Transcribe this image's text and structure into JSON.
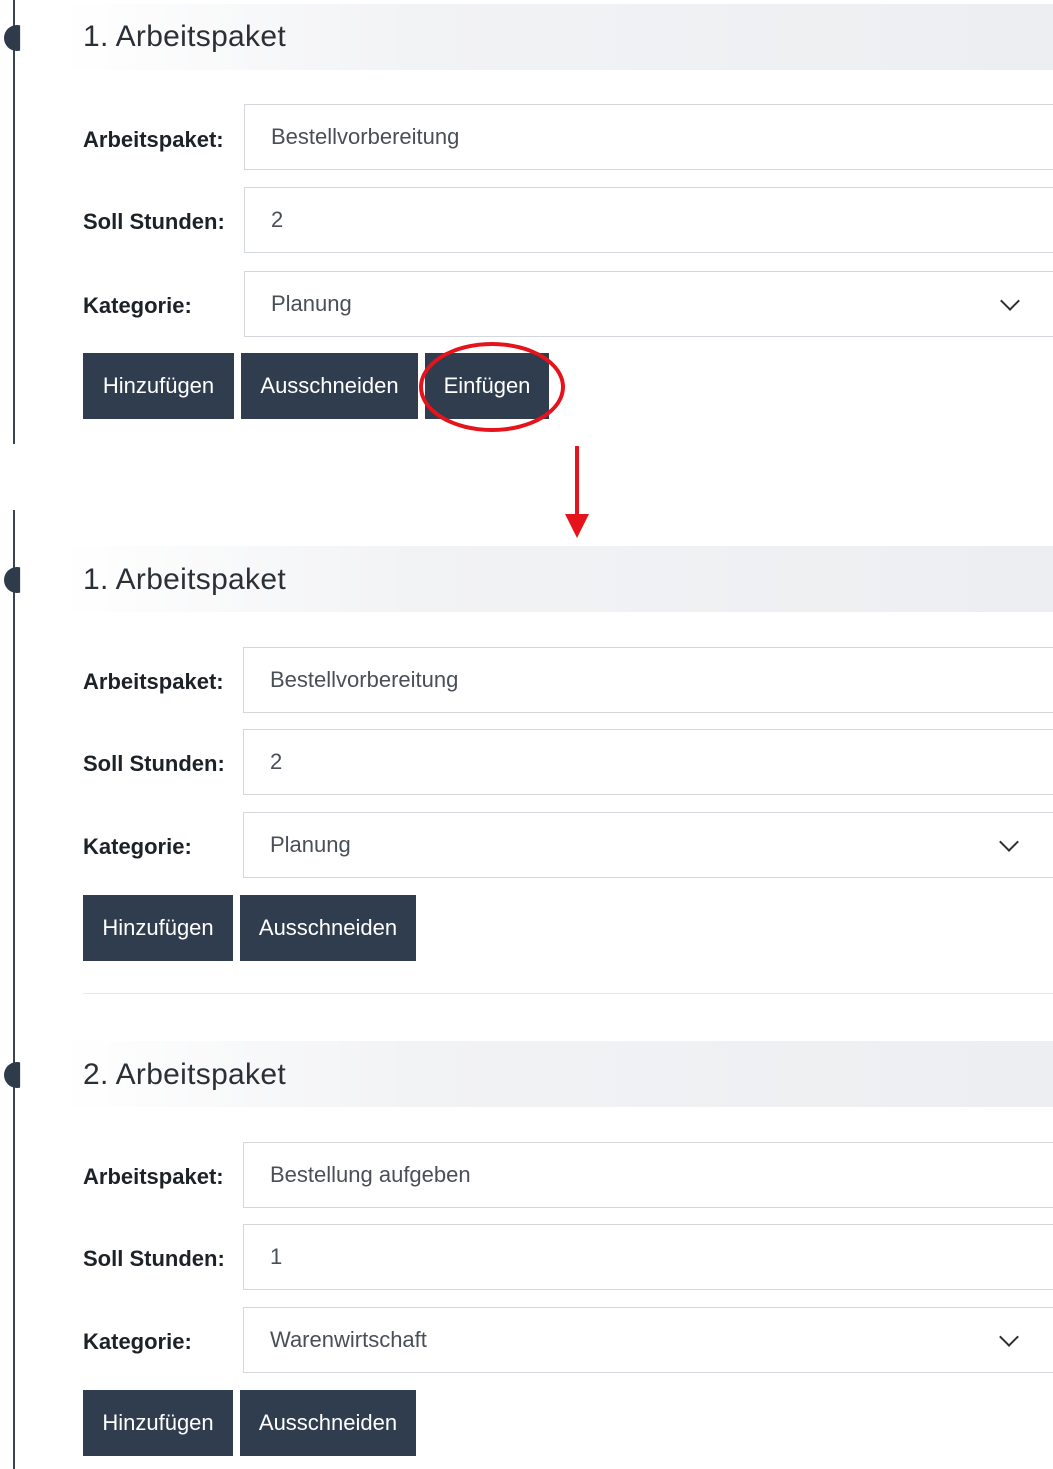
{
  "before": {
    "header": {
      "title": "1. Arbeitspaket"
    },
    "fields": {
      "arbeitspaket": {
        "label": "Arbeitspaket:",
        "value": "Bestellvorbereitung"
      },
      "soll_stunden": {
        "label": "Soll Stunden:",
        "value": "2"
      },
      "kategorie": {
        "label": "Kategorie:",
        "value": "Planung"
      }
    },
    "buttons": {
      "add": "Hinzufügen",
      "cut": "Ausschneiden",
      "paste": "Einfügen"
    }
  },
  "after": {
    "packages": [
      {
        "title": "1. Arbeitspaket",
        "arbeitspaket": {
          "label": "Arbeitspaket:",
          "value": "Bestellvorbereitung"
        },
        "soll_stunden": {
          "label": "Soll Stunden:",
          "value": "2"
        },
        "kategorie": {
          "label": "Kategorie:",
          "value": "Planung"
        },
        "buttons": {
          "add": "Hinzufügen",
          "cut": "Ausschneiden"
        }
      },
      {
        "title": "2. Arbeitspaket",
        "arbeitspaket": {
          "label": "Arbeitspaket:",
          "value": "Bestellung aufgeben"
        },
        "soll_stunden": {
          "label": "Soll Stunden:",
          "value": "1"
        },
        "kategorie": {
          "label": "Kategorie:",
          "value": "Warenwirtschaft"
        },
        "buttons": {
          "add": "Hinzufügen",
          "cut": "Ausschneiden"
        }
      }
    ]
  },
  "annotation": {
    "highlight_color": "#e5141c",
    "arrow_color": "#e5141c"
  },
  "colors": {
    "button_bg": "#2f3d4f",
    "timeline": "#2f3b4b"
  }
}
